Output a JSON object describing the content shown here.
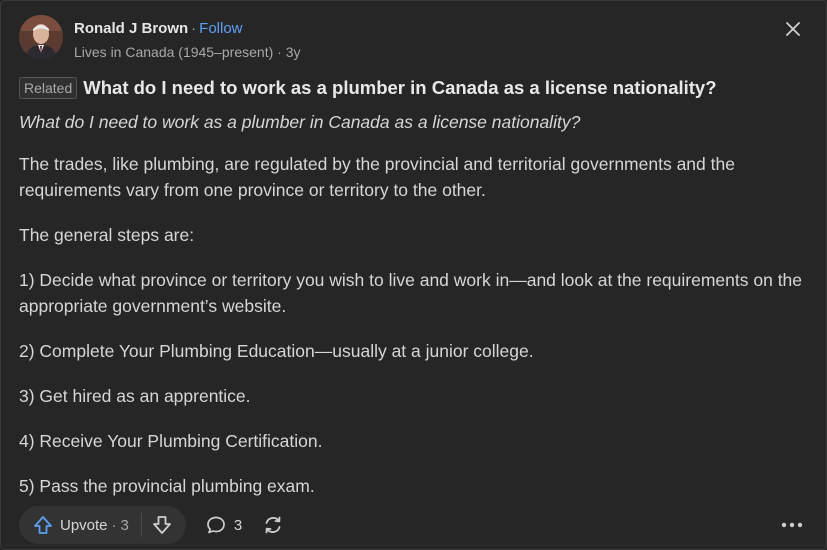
{
  "author": {
    "name": "Ronald J Brown",
    "follow_label": "Follow",
    "credential": "Lives in Canada (1945–present)",
    "age": "3y"
  },
  "question": {
    "related_badge": "Related",
    "title": "What do I need to work as a plumber in Canada as a license nationality?"
  },
  "answer": {
    "question_repeat": "What do I need to work as a plumber in Canada as a license nationality?",
    "paragraphs": [
      "The trades, like plumbing, are regulated by the provincial and territorial governments and the requirements vary from one province or territory to the other.",
      "The general steps are:",
      "1) Decide what province or territory you wish to live and work in—and look at the requirements on the appropriate government’s website.",
      "2) Complete Your Plumbing Education—usually at a junior college.",
      "3) Get hired as an apprentice.",
      "4) Receive Your Plumbing Certification.",
      "5) Pass the provincial plumbing exam."
    ]
  },
  "footer": {
    "upvote_label": "Upvote",
    "upvote_count": "3",
    "comment_count": "3"
  },
  "icons": {
    "close": "close-icon",
    "upvote": "upvote-arrow-icon",
    "downvote": "downvote-arrow-icon",
    "comment": "comment-bubble-icon",
    "share": "share-cycle-icon",
    "more": "more-dots-icon"
  },
  "colors": {
    "background": "#262626",
    "accent": "#5aa0f5",
    "text": "#d6d6d6",
    "upvote_blue": "#5aa0f5"
  }
}
